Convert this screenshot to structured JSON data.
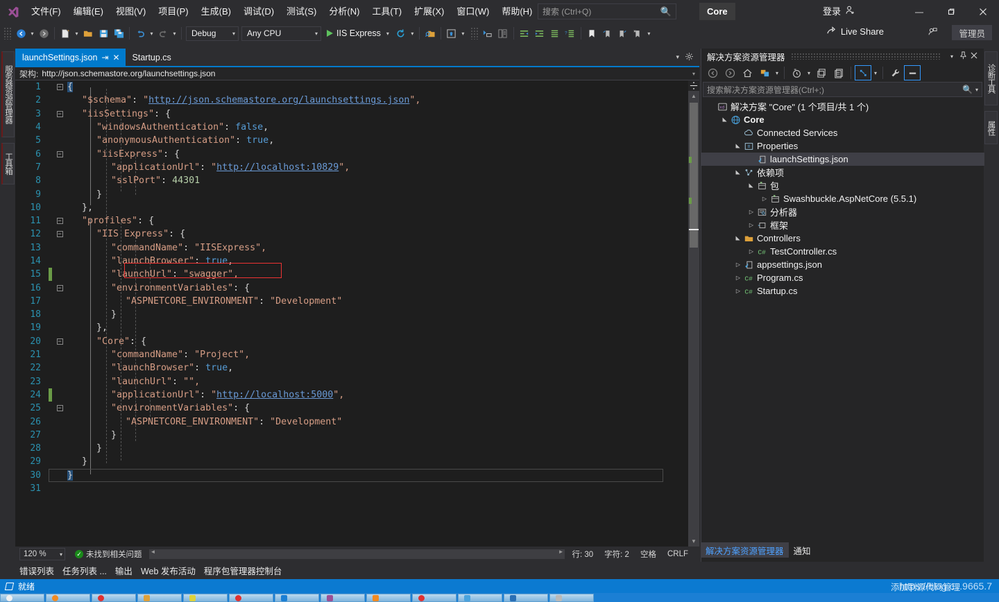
{
  "titlebar": {
    "menus": [
      "文件(F)",
      "编辑(E)",
      "视图(V)",
      "项目(P)",
      "生成(B)",
      "调试(D)",
      "测试(S)",
      "分析(N)",
      "工具(T)",
      "扩展(X)",
      "窗口(W)",
      "帮助(H)"
    ],
    "search_placeholder": "搜索 (Ctrl+Q)",
    "search_icon": "magnifier-icon",
    "project_chip": "Core",
    "signin_label": "登录",
    "signin_icon": "person-add-icon",
    "minimize": "—",
    "maximize": "❐",
    "close": "✕"
  },
  "toolbar": {
    "configuration": "Debug",
    "platform": "Any CPU",
    "start_label": "IIS Express",
    "live_share_label": "Live Share",
    "admin_label": "管理员",
    "icons": [
      "navigate-back-icon",
      "navigate-forward-icon",
      "new-project-icon",
      "open-file-icon",
      "save-icon",
      "save-all-icon",
      "undo-icon",
      "redo-icon",
      "start-debug-icon",
      "refresh-icon",
      "find-in-files-icon",
      "browser-preview-icon",
      "attach-snapshot-icon",
      "compare-icon",
      "outdent-icon",
      "indent-icon",
      "comment-icon",
      "uncomment-icon",
      "bookmark-icon",
      "prev-bookmark-icon",
      "next-bookmark-icon",
      "clear-bookmarks-icon"
    ]
  },
  "left_dock": {
    "tabs": [
      "服务器资源管理器",
      "工具箱"
    ]
  },
  "right_dock": {
    "tabs": [
      "诊断工具",
      "属性"
    ]
  },
  "editor": {
    "tabs": [
      {
        "label": "launchSettings.json",
        "active": true,
        "pin": "⇥",
        "close": "✕"
      },
      {
        "label": "Startup.cs",
        "active": false
      }
    ],
    "tabstrip_icons": [
      "tab-list-chevron-icon",
      "tab-options-gear-icon"
    ],
    "schema_label": "架构:",
    "schema_value": "http://json.schemastore.org/launchsettings.json",
    "lines": [
      {
        "n": 1,
        "fold": "minus",
        "indent": 0,
        "change": "",
        "segs": [
          {
            "t": "{",
            "c": "p",
            "sel": true
          }
        ]
      },
      {
        "n": 2,
        "fold": "",
        "indent": 1,
        "change": "",
        "segs": [
          {
            "t": "\"$schema\"",
            "c": "k"
          },
          {
            "t": ": ",
            "c": "p"
          },
          {
            "t": "\"",
            "c": "s"
          },
          {
            "t": "http://json.schemastore.org/launchsettings.json",
            "c": "u"
          },
          {
            "t": "\",",
            "c": "s"
          }
        ]
      },
      {
        "n": 3,
        "fold": "minus",
        "indent": 1,
        "change": "",
        "segs": [
          {
            "t": "\"iisSettings\"",
            "c": "k"
          },
          {
            "t": ": {",
            "c": "p"
          }
        ]
      },
      {
        "n": 4,
        "fold": "",
        "indent": 2,
        "change": "",
        "segs": [
          {
            "t": "\"windowsAuthentication\"",
            "c": "k"
          },
          {
            "t": ": ",
            "c": "p"
          },
          {
            "t": "false",
            "c": "b"
          },
          {
            "t": ",",
            "c": "p"
          }
        ]
      },
      {
        "n": 5,
        "fold": "",
        "indent": 2,
        "change": "",
        "segs": [
          {
            "t": "\"anonymousAuthentication\"",
            "c": "k"
          },
          {
            "t": ": ",
            "c": "p"
          },
          {
            "t": "true",
            "c": "b"
          },
          {
            "t": ",",
            "c": "p"
          }
        ]
      },
      {
        "n": 6,
        "fold": "minus",
        "indent": 2,
        "change": "",
        "segs": [
          {
            "t": "\"iisExpress\"",
            "c": "k"
          },
          {
            "t": ": {",
            "c": "p"
          }
        ]
      },
      {
        "n": 7,
        "fold": "",
        "indent": 3,
        "change": "",
        "segs": [
          {
            "t": "\"applicationUrl\"",
            "c": "k"
          },
          {
            "t": ": ",
            "c": "p"
          },
          {
            "t": "\"",
            "c": "s"
          },
          {
            "t": "http://localhost:10829",
            "c": "u"
          },
          {
            "t": "\",",
            "c": "s"
          }
        ]
      },
      {
        "n": 8,
        "fold": "",
        "indent": 3,
        "change": "",
        "segs": [
          {
            "t": "\"sslPort\"",
            "c": "k"
          },
          {
            "t": ": ",
            "c": "p"
          },
          {
            "t": "44301",
            "c": "n"
          }
        ]
      },
      {
        "n": 9,
        "fold": "",
        "indent": 2,
        "change": "",
        "segs": [
          {
            "t": "}",
            "c": "p"
          }
        ]
      },
      {
        "n": 10,
        "fold": "",
        "indent": 1,
        "change": "",
        "segs": [
          {
            "t": "},",
            "c": "p"
          }
        ]
      },
      {
        "n": 11,
        "fold": "minus",
        "indent": 1,
        "change": "",
        "segs": [
          {
            "t": "\"profiles\"",
            "c": "k"
          },
          {
            "t": ": {",
            "c": "p"
          }
        ]
      },
      {
        "n": 12,
        "fold": "minus",
        "indent": 2,
        "change": "",
        "segs": [
          {
            "t": "\"IIS Express\"",
            "c": "k"
          },
          {
            "t": ": {",
            "c": "p"
          }
        ]
      },
      {
        "n": 13,
        "fold": "",
        "indent": 3,
        "change": "",
        "segs": [
          {
            "t": "\"commandName\"",
            "c": "k"
          },
          {
            "t": ": ",
            "c": "p"
          },
          {
            "t": "\"IISExpress\",",
            "c": "s"
          }
        ]
      },
      {
        "n": 14,
        "fold": "",
        "indent": 3,
        "change": "",
        "segs": [
          {
            "t": "\"launchBrowser\"",
            "c": "k"
          },
          {
            "t": ": ",
            "c": "p"
          },
          {
            "t": "true",
            "c": "b"
          },
          {
            "t": ",",
            "c": "p"
          }
        ]
      },
      {
        "n": 15,
        "fold": "",
        "indent": 3,
        "change": "mod",
        "segs": [
          {
            "t": "\"launchUrl\"",
            "c": "k"
          },
          {
            "t": ": ",
            "c": "p"
          },
          {
            "t": "\"swagger\",",
            "c": "s"
          }
        ]
      },
      {
        "n": 16,
        "fold": "minus",
        "indent": 3,
        "change": "",
        "segs": [
          {
            "t": "\"environmentVariables\"",
            "c": "k"
          },
          {
            "t": ": {",
            "c": "p"
          }
        ]
      },
      {
        "n": 17,
        "fold": "",
        "indent": 4,
        "change": "",
        "segs": [
          {
            "t": "\"ASPNETCORE_ENVIRONMENT\"",
            "c": "k"
          },
          {
            "t": ": ",
            "c": "p"
          },
          {
            "t": "\"Development\"",
            "c": "s"
          }
        ]
      },
      {
        "n": 18,
        "fold": "",
        "indent": 3,
        "change": "",
        "segs": [
          {
            "t": "}",
            "c": "p"
          }
        ]
      },
      {
        "n": 19,
        "fold": "",
        "indent": 2,
        "change": "",
        "segs": [
          {
            "t": "},",
            "c": "p"
          }
        ]
      },
      {
        "n": 20,
        "fold": "minus",
        "indent": 2,
        "change": "",
        "segs": [
          {
            "t": "\"Core\"",
            "c": "k"
          },
          {
            "t": ": {",
            "c": "p"
          }
        ]
      },
      {
        "n": 21,
        "fold": "",
        "indent": 3,
        "change": "",
        "segs": [
          {
            "t": "\"commandName\"",
            "c": "k"
          },
          {
            "t": ": ",
            "c": "p"
          },
          {
            "t": "\"Project\",",
            "c": "s"
          }
        ]
      },
      {
        "n": 22,
        "fold": "",
        "indent": 3,
        "change": "",
        "segs": [
          {
            "t": "\"launchBrowser\"",
            "c": "k"
          },
          {
            "t": ": ",
            "c": "p"
          },
          {
            "t": "true",
            "c": "b"
          },
          {
            "t": ",",
            "c": "p"
          }
        ]
      },
      {
        "n": 23,
        "fold": "",
        "indent": 3,
        "change": "",
        "segs": [
          {
            "t": "\"launchUrl\"",
            "c": "k"
          },
          {
            "t": ": ",
            "c": "p"
          },
          {
            "t": "\"\",",
            "c": "s"
          }
        ]
      },
      {
        "n": 24,
        "fold": "",
        "indent": 3,
        "change": "mod",
        "segs": [
          {
            "t": "\"applicationUrl\"",
            "c": "k"
          },
          {
            "t": ": ",
            "c": "p"
          },
          {
            "t": "\"",
            "c": "s"
          },
          {
            "t": "http://localhost:5000",
            "c": "u"
          },
          {
            "t": "\",",
            "c": "s"
          }
        ]
      },
      {
        "n": 25,
        "fold": "minus",
        "indent": 3,
        "change": "",
        "segs": [
          {
            "t": "\"environmentVariables\"",
            "c": "k"
          },
          {
            "t": ": {",
            "c": "p"
          }
        ]
      },
      {
        "n": 26,
        "fold": "",
        "indent": 4,
        "change": "",
        "segs": [
          {
            "t": "\"ASPNETCORE_ENVIRONMENT\"",
            "c": "k"
          },
          {
            "t": ": ",
            "c": "p"
          },
          {
            "t": "\"Development\"",
            "c": "s"
          }
        ]
      },
      {
        "n": 27,
        "fold": "",
        "indent": 3,
        "change": "",
        "segs": [
          {
            "t": "}",
            "c": "p"
          }
        ]
      },
      {
        "n": 28,
        "fold": "",
        "indent": 2,
        "change": "",
        "segs": [
          {
            "t": "}",
            "c": "p"
          }
        ]
      },
      {
        "n": 29,
        "fold": "",
        "indent": 1,
        "change": "",
        "segs": [
          {
            "t": "}",
            "c": "p"
          }
        ]
      },
      {
        "n": 30,
        "fold": "",
        "indent": 0,
        "change": "",
        "segs": [
          {
            "t": "}",
            "c": "p",
            "sel": true
          }
        ]
      },
      {
        "n": 31,
        "fold": "",
        "indent": 0,
        "change": "",
        "segs": []
      }
    ]
  },
  "edit_status": {
    "zoom": "120 %",
    "issue_text": "未找到相关问题",
    "issue_icon": "check-circle-icon",
    "line": "行: 30",
    "col": "字符: 2",
    "spaces": "空格",
    "eol": "CRLF"
  },
  "bottom_tabs": [
    "错误列表",
    "任务列表 ...",
    "输出",
    "Web 发布活动",
    "程序包管理器控制台"
  ],
  "solution_explorer": {
    "title": "解决方案资源管理器",
    "header_icons": [
      "chevron-down-icon",
      "pin-icon",
      "close-icon"
    ],
    "toolbar_icons": [
      "back-icon",
      "forward-icon",
      "home-icon",
      "switch-views-icon",
      "pending-changes-icon",
      "collapse-all-icon",
      "show-all-files-icon",
      "sync-with-active-document-icon",
      "properties-wrench-icon",
      "preview-selected-items-icon"
    ],
    "search_placeholder": "搜索解决方案资源管理器(Ctrl+;)",
    "search_icon": "magnifier-icon",
    "tree": [
      {
        "depth": 0,
        "twisty": "",
        "icon": "solution-icon",
        "label": "解决方案 \"Core\" (1 个项目/共 1 个)",
        "bold": false,
        "selected": false
      },
      {
        "depth": 1,
        "twisty": "open",
        "icon": "web-project-icon",
        "label": "Core",
        "bold": true,
        "selected": false
      },
      {
        "depth": 2,
        "twisty": "",
        "icon": "connected-services-icon",
        "label": "Connected Services",
        "bold": false,
        "selected": false
      },
      {
        "depth": 2,
        "twisty": "open",
        "icon": "properties-folder-icon",
        "label": "Properties",
        "bold": false,
        "selected": false
      },
      {
        "depth": 3,
        "twisty": "",
        "icon": "json-file-icon",
        "label": "launchSettings.json",
        "bold": false,
        "selected": true
      },
      {
        "depth": 2,
        "twisty": "open",
        "icon": "dependencies-icon",
        "label": "依赖项",
        "bold": false,
        "selected": false
      },
      {
        "depth": 3,
        "twisty": "open",
        "icon": "package-icon",
        "label": "包",
        "bold": false,
        "selected": false
      },
      {
        "depth": 4,
        "twisty": "closed",
        "icon": "package-icon",
        "label": "Swashbuckle.AspNetCore (5.5.1)",
        "bold": false,
        "selected": false
      },
      {
        "depth": 3,
        "twisty": "closed",
        "icon": "analyzers-icon",
        "label": "分析器",
        "bold": false,
        "selected": false
      },
      {
        "depth": 3,
        "twisty": "closed",
        "icon": "frameworks-icon",
        "label": "框架",
        "bold": false,
        "selected": false
      },
      {
        "depth": 2,
        "twisty": "open",
        "icon": "folder-icon",
        "label": "Controllers",
        "bold": false,
        "selected": false
      },
      {
        "depth": 3,
        "twisty": "closed",
        "icon": "csharp-file-icon",
        "label": "TestController.cs",
        "bold": false,
        "selected": false
      },
      {
        "depth": 2,
        "twisty": "closed",
        "icon": "json-file-icon",
        "label": "appsettings.json",
        "bold": false,
        "selected": false
      },
      {
        "depth": 2,
        "twisty": "closed",
        "icon": "csharp-file-icon",
        "label": "Program.cs",
        "bold": false,
        "selected": false
      },
      {
        "depth": 2,
        "twisty": "closed",
        "icon": "csharp-file-icon",
        "label": "Startup.cs",
        "bold": false,
        "selected": false
      }
    ],
    "dock_tabs": [
      {
        "label": "解决方案资源管理器",
        "active": true
      },
      {
        "label": "通知",
        "active": false
      }
    ]
  },
  "os": {
    "status_text": "就绪",
    "status_icon": "window-icon",
    "watermark_main": "https://blog.c...9665.7",
    "watermark_overlay": "添加到源代码管理"
  },
  "annotations": {
    "code_box_label": "launchUrl-swagger-highlight",
    "tree_box_label": "properties-launchsettings-highlight",
    "color": "#ee3333"
  }
}
